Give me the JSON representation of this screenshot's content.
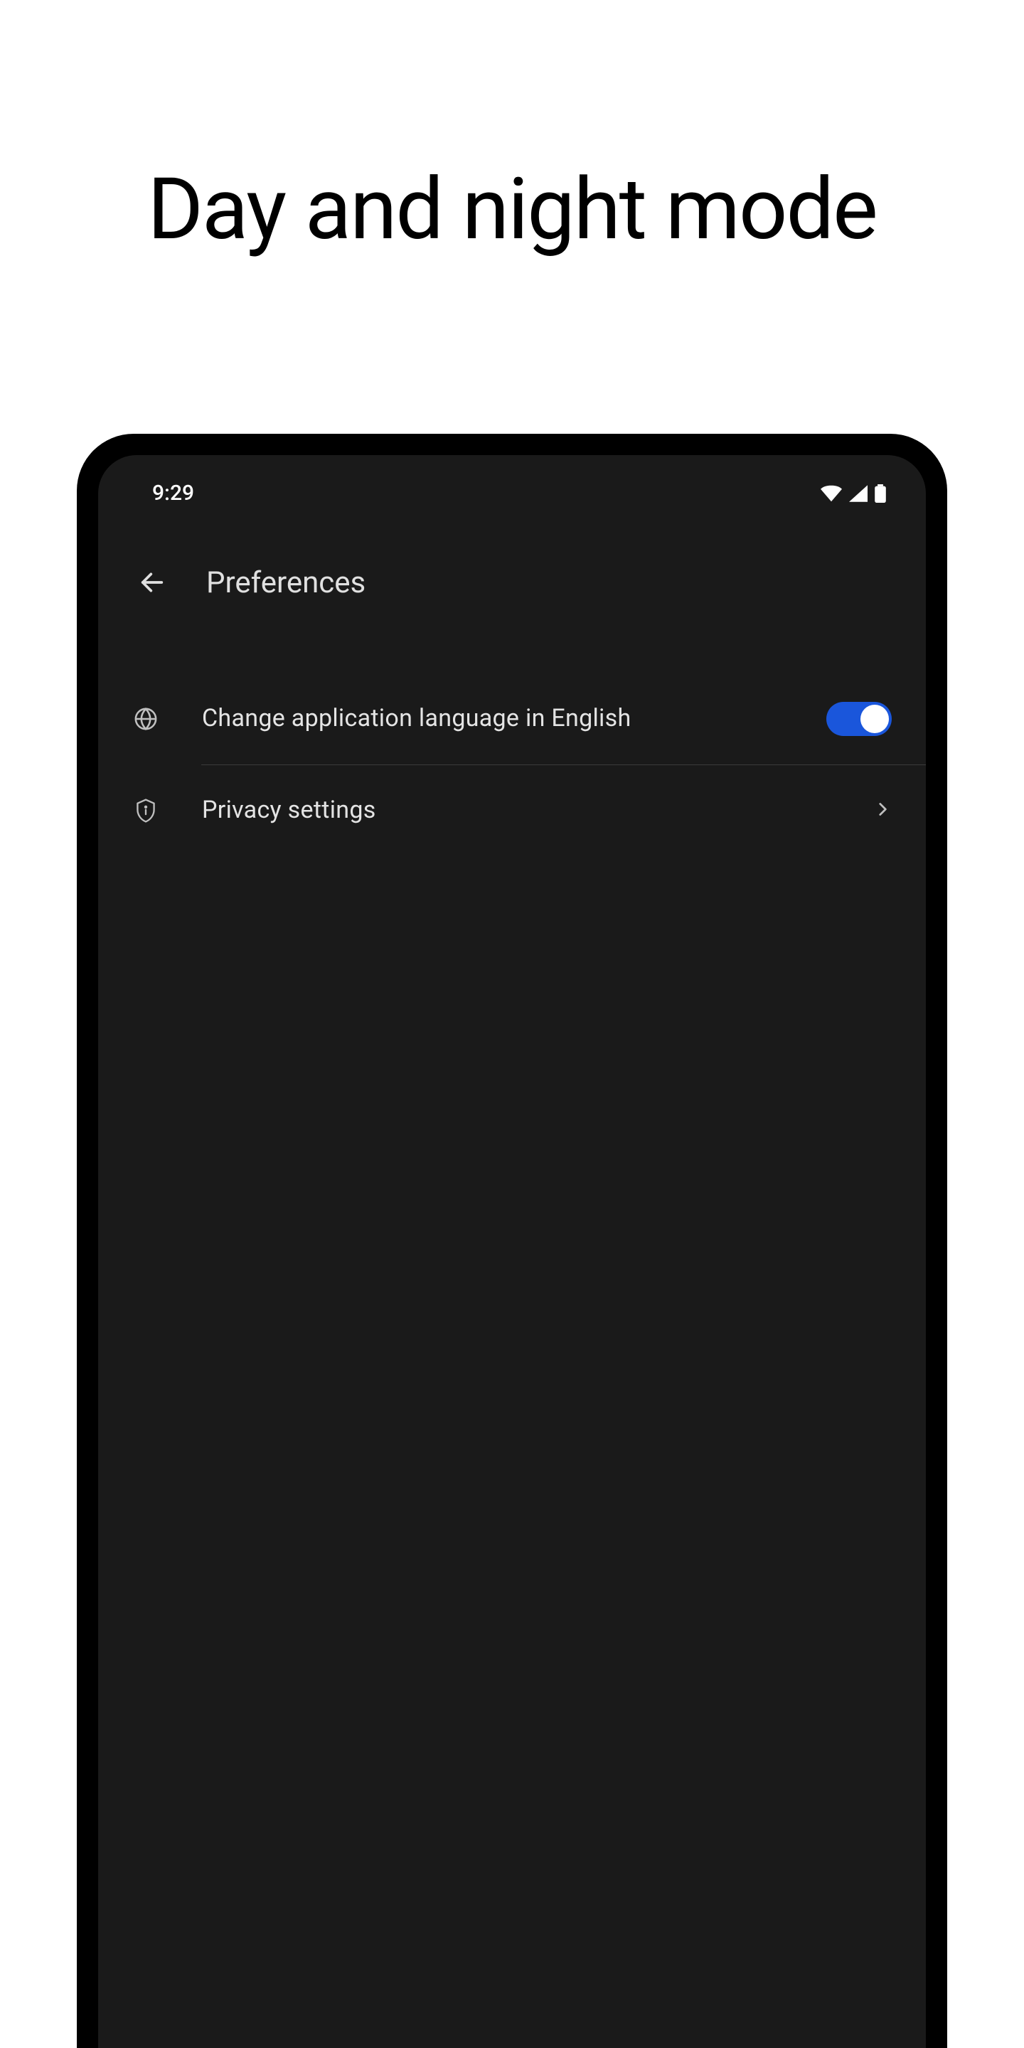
{
  "page": {
    "title": "Day and night mode"
  },
  "statusBar": {
    "time": "9:29"
  },
  "appBar": {
    "title": "Preferences"
  },
  "settings": {
    "language": {
      "label": "Change application language in English",
      "enabled": true
    },
    "privacy": {
      "label": "Privacy settings"
    }
  },
  "icons": {
    "back": "back-arrow-icon",
    "globe": "globe-icon",
    "shield": "shield-icon",
    "chevron": "chevron-right-icon",
    "wifi": "wifi-icon",
    "signal": "signal-icon",
    "battery": "battery-icon"
  },
  "colors": {
    "screenBg": "#1a1a1a",
    "frameBg": "#000000",
    "textPrimary": "#e4e4e4",
    "toggleAccent": "#1a56db",
    "divider": "#3a3a3a"
  }
}
